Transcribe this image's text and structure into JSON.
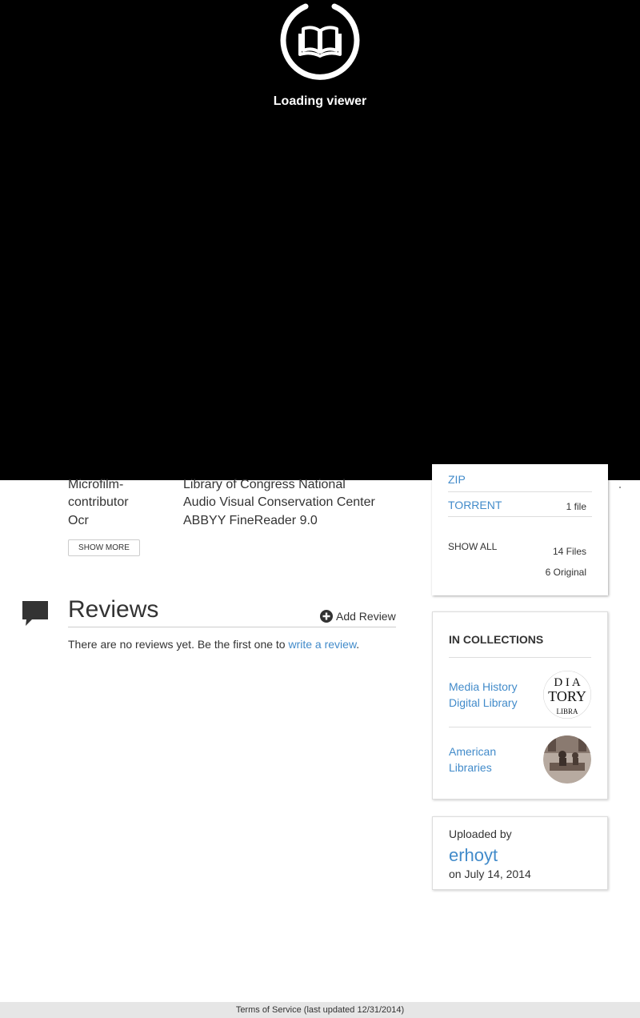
{
  "viewer": {
    "loading_text": "Loading viewer"
  },
  "metadata": {
    "rows": [
      {
        "key": "Microfilm-",
        "value": "Library of Congress National"
      },
      {
        "key": "contributor",
        "value": "Audio Visual Conservation Center"
      },
      {
        "key": "Ocr",
        "value": "ABBYY FineReader 9.0"
      }
    ],
    "show_more_label": "SHOW MORE"
  },
  "reviews": {
    "title": "Reviews",
    "add_review_label": "Add Review",
    "empty_text": "There are no reviews yet. Be the first one to ",
    "write_review_link": "write a review",
    "empty_text_end": "."
  },
  "downloads": {
    "zip_label": "ZIP",
    "torrent_label": "TORRENT",
    "torrent_count": "1 file",
    "show_all_label": "SHOW ALL",
    "total_files": "14 Files",
    "original_files": "6 Original"
  },
  "collections": {
    "heading": "IN COLLECTIONS",
    "items": [
      {
        "label": "Media History Digital Library",
        "thumb_text": "DIA\nTORY\nLIBRA"
      },
      {
        "label": "American Libraries"
      }
    ]
  },
  "uploader": {
    "label": "Uploaded by",
    "username": "erhoyt",
    "date_prefix": "on",
    "date": "July 14, 2014"
  },
  "footer": {
    "terms_link": "Terms of Service",
    "terms_note": "(last updated 12/31/2014)"
  },
  "colors": {
    "link": "#428bca",
    "viewer_bg": "#000000",
    "footer_bg": "#e6e6e6"
  }
}
